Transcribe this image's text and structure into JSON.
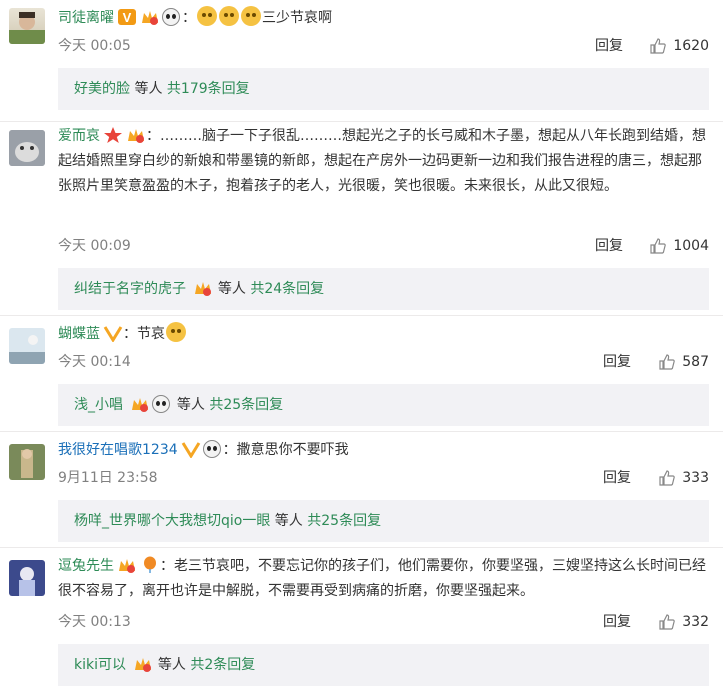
{
  "comments": [
    {
      "user": "司徒离曜",
      "separator": "：",
      "text": "三少节哀啊",
      "time": "今天 00:05",
      "reply_label": "回复",
      "likes": "1620",
      "summary": {
        "who": "好美的脸",
        "mid": "等人",
        "count": "共179条回复"
      }
    },
    {
      "user": "爱而哀",
      "separator": "：",
      "text": "………脑子一下子很乱………想起光之子的长弓威和木子墨，想起从八年长跑到结婚，想起结婚照里穿白纱的新娘和带墨镜的新郎，想起在产房外一边码更新一边和我们报告进程的唐三，想起那张照片里笑意盈盈的木子，抱着孩子的老人，光很暖，笑也很暖。未来很长，从此又很短。",
      "time": "今天 00:09",
      "reply_label": "回复",
      "likes": "1004",
      "summary": {
        "who": "纠结于名字的虎子",
        "mid": "等人",
        "count": "共24条回复"
      }
    },
    {
      "user": "蝴蝶蓝",
      "separator": "：",
      "text": "节哀",
      "time": "今天 00:14",
      "reply_label": "回复",
      "likes": "587",
      "summary": {
        "who": "浅_小唱",
        "mid": "等人",
        "count": "共25条回复"
      }
    },
    {
      "user": "我很好在唱歌1234",
      "separator": "：",
      "text": "撒意思你不要吓我",
      "time": "9月11日 23:58",
      "reply_label": "回复",
      "likes": "333",
      "summary": {
        "who": "杨咩_世界哪个大我想切qio一眼",
        "mid": "等人",
        "count": "共25条回复"
      }
    },
    {
      "user": "逗兔先生",
      "separator": "：",
      "text": "老三节哀吧，不要忘记你的孩子们，他们需要你，你要坚强，三嫂坚持这么长时间已经很不容易了，离开也许是中解脱，不需要再受到病痛的折磨，你要坚强起来。",
      "time": "今天 00:13",
      "reply_label": "回复",
      "likes": "332",
      "summary": {
        "who": "kiki可以",
        "mid": "等人",
        "count": "共2条回复"
      }
    }
  ],
  "colors": {
    "link_green": "#2e8b57",
    "summary_bg": "#f2f2f5"
  }
}
